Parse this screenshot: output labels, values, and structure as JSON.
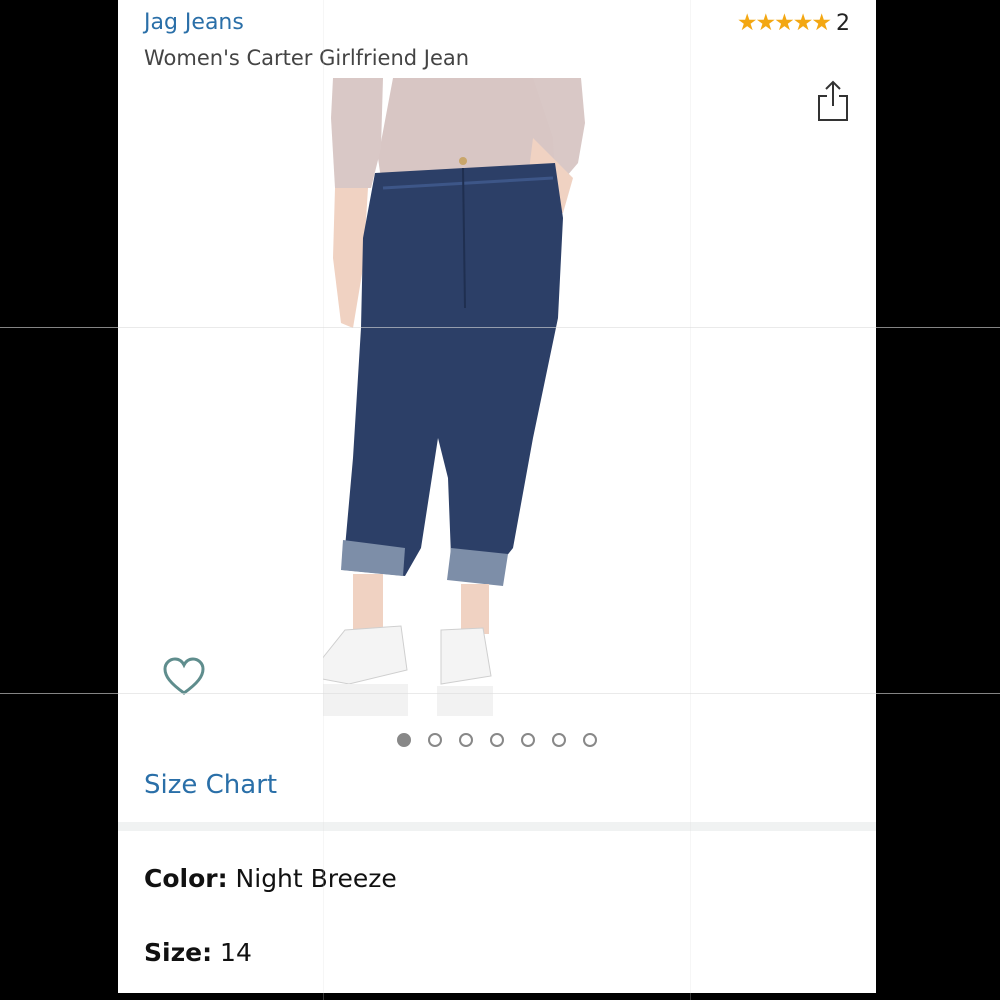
{
  "product": {
    "brand": "Jag Jeans",
    "title": "Women's Carter Girlfriend Jean",
    "rating_count": "2",
    "stars": "★★★★★",
    "image_count": 7,
    "active_image_index": 0
  },
  "links": {
    "size_chart": "Size Chart"
  },
  "attributes": {
    "color_label": "Color:",
    "color_value": " Night Breeze",
    "size_label": "Size:",
    "size_value": " 14"
  },
  "colors": {
    "link_blue": "#2a6fa8",
    "star_gold": "#f3a712",
    "denim": "#2c3f67"
  },
  "icons": {
    "share": "share-icon",
    "wishlist": "heart-outline-icon"
  }
}
